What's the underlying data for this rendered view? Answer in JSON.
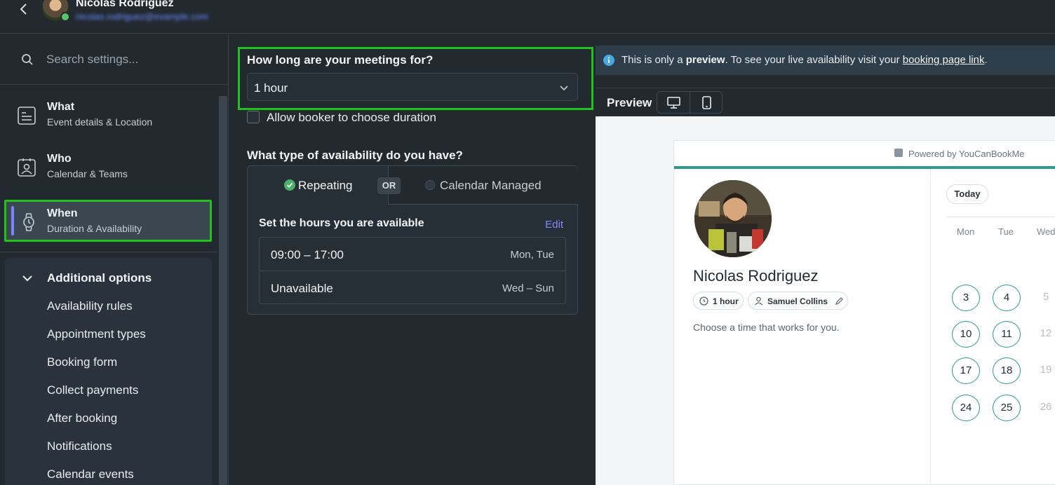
{
  "header": {
    "user_name": "Nicolas Rodriguez",
    "user_email": "nicolas.rodriguez@example.com"
  },
  "sidebar": {
    "search_placeholder": "Search settings...",
    "items": [
      {
        "title": "What",
        "subtitle": "Event details & Location",
        "icon": "document-icon"
      },
      {
        "title": "Who",
        "subtitle": "Calendar & Teams",
        "icon": "contact-card-icon"
      },
      {
        "title": "When",
        "subtitle": "Duration & Availability",
        "icon": "watch-icon",
        "active": true
      }
    ],
    "additional": {
      "title": "Additional options",
      "items": [
        "Availability rules",
        "Appointment types",
        "Booking form",
        "Collect payments",
        "After booking",
        "Notifications",
        "Calendar events"
      ]
    }
  },
  "main": {
    "duration_label": "How long are your meetings for?",
    "duration_value": "1 hour",
    "allow_choose_label": "Allow booker to choose duration",
    "availability_label": "What type of availability do you have?",
    "tabs": {
      "repeating": "Repeating",
      "or": "OR",
      "calendar_managed": "Calendar Managed"
    },
    "hours_title": "Set the hours you are available",
    "edit_label": "Edit",
    "hours": [
      {
        "time": "09:00 – 17:00",
        "days": "Mon, Tue"
      },
      {
        "time": "Unavailable",
        "days": "Wed – Sun"
      }
    ]
  },
  "preview": {
    "info_bold_start": "This is only a ",
    "info_bold": "preview",
    "info_rest": ". To see your live availability visit your ",
    "info_link": "booking page link",
    "info_end": ".",
    "label": "Preview",
    "powered_by": "Powered by YouCanBookMe",
    "host_name": "Nicolas Rodriguez",
    "duration_chip": "1 hour",
    "host_chip": "Samuel Collins",
    "choose_text": "Choose a time that works for you.",
    "today_label": "Today",
    "weekdays": [
      "Mon",
      "Tue",
      "Wed"
    ],
    "weeks": [
      [
        "3",
        "4",
        "5"
      ],
      [
        "10",
        "11",
        "12"
      ],
      [
        "17",
        "18",
        "19"
      ],
      [
        "24",
        "25",
        "26"
      ]
    ]
  },
  "colors": {
    "highlight": "#22c11f",
    "accent": "#7a86ff",
    "teal": "#2a9a8a"
  }
}
